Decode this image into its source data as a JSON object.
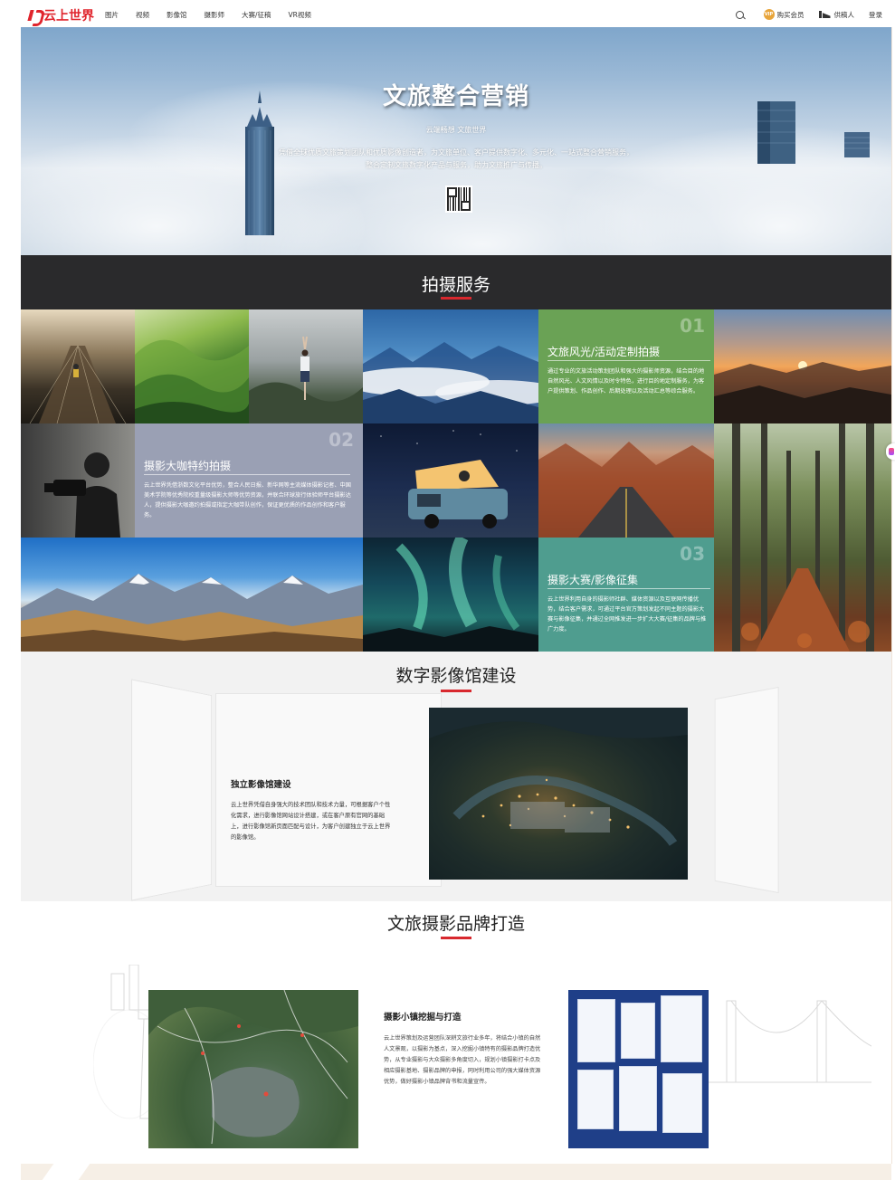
{
  "header": {
    "logo_text": "云上世界",
    "nav": [
      "图片",
      "视频",
      "影像馆",
      "摄影师",
      "大赛/征稿",
      "VR视频"
    ],
    "vip_badge": "VIP",
    "buy_vip": "购买会员",
    "contributor": "供稿人",
    "login": "登录"
  },
  "hero": {
    "title": "文旅整合营销",
    "subtitle": "云端畅想 文旅世界",
    "description": "凭借全球优质文旅策划团队和优质影像创造者，为文旅单位、客户提供数字化、多元化、一站式整合营销服务，整合定制文旅数字化产品与服务，助力文旅推广与传播。"
  },
  "shooting": {
    "title": "拍摄服务",
    "panels": [
      {
        "num": "01",
        "title": "文旅风光/活动定制拍摄",
        "desc": "通过专业的文旅活动策划团队和强大的摄影师资源，结合目的地自然风光、人文风情以及时令特色，进行目的地定制服务，为客户提供策划、作品创作、后期处理以及活动汇总等综合服务。",
        "color": "#6aa255"
      },
      {
        "num": "02",
        "title": "摄影大咖特约拍摄",
        "desc": "云上世界凭借浙数文化平台优势，整合人民日报、新华网等主流媒体摄影记者、中国美术学院等优秀院校重量级摄影大师等优势资源，并联合环球旅行体验师平台摄影达人，提供摄影大咖邀约拍摄或指定大咖带队创作，保证更优质的作品创作和客户服务。",
        "color": "#9aa0b4"
      },
      {
        "num": "03",
        "title": "摄影大赛/影像征集",
        "desc": "云上世界利用自身的摄影师社群、媒体资源以及互联网传播优势，结合客户需求，可通过平台官方策划发起不同主题的摄影大赛与影像征集，并通过全网推发进一步扩大大赛/征集的品牌与推广力度。",
        "color": "#4f9d8f"
      }
    ]
  },
  "museum": {
    "title": "数字影像馆建设",
    "card_title": "独立影像馆建设",
    "card_desc": "云上世界凭借自身强大的技术团队和技术力量，可根据客户个性化需求，进行影像馆网站设计搭建，或在客户原有官网的基础上，进行影像馆新页面匹配与设计，为客户创建独立于云上世界的影像馆。"
  },
  "brand": {
    "title": "文旅摄影品牌打造",
    "card_title": "摄影小镇挖掘与打造",
    "card_desc": "云上世界策划及运营团队深耕文旅行业多年，将结合小镇的自然人文景观，以摄影为基点，深入挖掘小镇特有的摄影品牌打造优势，从专业摄影与大众摄影多角度切入，规划小镇摄影打卡点及相应摄影基地、摄影品牌的申报，同时利用公司的强大媒体资源优势，做好摄影小镇品牌背书和流量宣传。"
  },
  "colors": {
    "brand_red": "#e0242c",
    "accent_bar": "#d8282e",
    "dark_band": "#2a2a2c"
  }
}
